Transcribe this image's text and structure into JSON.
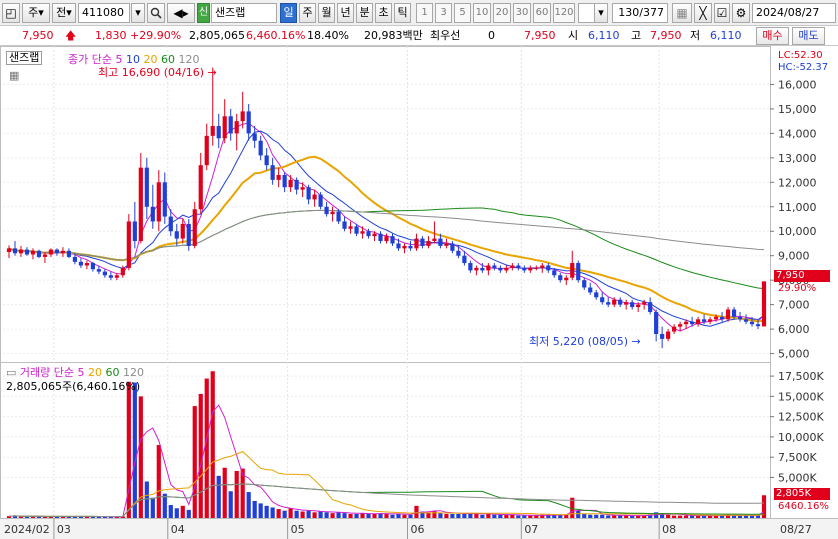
{
  "toolbar": {
    "market": "주",
    "scope": "전",
    "code": "411080",
    "badge": "신",
    "name": "샌즈랩",
    "timeframes": [
      "일",
      "주",
      "월",
      "년",
      "분",
      "초",
      "틱"
    ],
    "active_timeframe": "일",
    "periods": [
      "1",
      "3",
      "5",
      "10",
      "20",
      "30",
      "60",
      "120"
    ],
    "bar_count": "130/377",
    "date": "2024/08/27"
  },
  "pricebar": {
    "price": "7,950",
    "change": "1,830",
    "change_pct": "+29.90%",
    "volume": "2,805,065",
    "volume_pct": "6,460.16%",
    "turnover": "18.40%",
    "amount": "20,983백만",
    "preferred_label": "최우선",
    "preferred_value": "0",
    "preferred_price": "7,950",
    "open_label": "시",
    "open_value": "6,110",
    "high_label": "고",
    "high_value": "7,950",
    "low_label": "저",
    "low_value": "6,110",
    "buy_label": "매수",
    "sell_label": "매도"
  },
  "price_panel": {
    "stock_tag": "샌즈랩",
    "ma_title": "종가 단순",
    "ma_periods": [
      "5",
      "10",
      "20",
      "60",
      "120"
    ],
    "ma_colors": [
      "#d020d0",
      "#1f3fd6",
      "#e8a400",
      "#1a8a1a",
      "#8c8c8c"
    ],
    "lc": "LC:52.30",
    "hc": "HC:-52.37",
    "high_marker": "최고 16,690 (04/16)",
    "low_marker": "최저 5,220 (08/05)",
    "current_price": "7,950",
    "current_pct": "29.90%",
    "y_ticks": [
      "16,000",
      "15,000",
      "14,000",
      "13,000",
      "12,000",
      "11,000",
      "10,000",
      "9,000",
      "8,000",
      "7,000",
      "6,000",
      "5,000"
    ]
  },
  "volume_panel": {
    "title": "거래량 단순",
    "ma_periods": [
      "5",
      "20",
      "60",
      "120"
    ],
    "ma_colors": [
      "#d020d0",
      "#e8a400",
      "#1a8a1a",
      "#8c8c8c"
    ],
    "current": "2,805,065주(6,460.16%)",
    "current_tag": "2,805K",
    "current_pct": "6460.16%",
    "y_ticks": [
      "17,500K",
      "15,000K",
      "12,500K",
      "10,000K",
      "7,500K",
      "5,000K"
    ]
  },
  "x_axis": {
    "labels": [
      "2024/02",
      "03",
      "04",
      "05",
      "06",
      "07",
      "08"
    ],
    "end_label": "08/27"
  },
  "chart_data": {
    "type": "candlestick",
    "volume_unit": "K shares",
    "price_ylim": [
      4900,
      17000
    ],
    "volume_ylim": [
      0,
      18500
    ],
    "candles": [
      {
        "o": 9150,
        "h": 9420,
        "l": 8900,
        "c": 9300,
        "v": 230
      },
      {
        "o": 9300,
        "h": 9600,
        "l": 9000,
        "c": 9100,
        "v": 280
      },
      {
        "o": 9100,
        "h": 9400,
        "l": 8950,
        "c": 9250,
        "v": 180
      },
      {
        "o": 9250,
        "h": 9350,
        "l": 9000,
        "c": 9050,
        "v": 160
      },
      {
        "o": 9050,
        "h": 9300,
        "l": 8850,
        "c": 9200,
        "v": 210
      },
      {
        "o": 9200,
        "h": 9250,
        "l": 8900,
        "c": 8950,
        "v": 190
      },
      {
        "o": 8950,
        "h": 9150,
        "l": 8700,
        "c": 9050,
        "v": 170
      },
      {
        "o": 9050,
        "h": 9300,
        "l": 8950,
        "c": 9250,
        "v": 200
      },
      {
        "o": 9250,
        "h": 9300,
        "l": 9000,
        "c": 9100,
        "v": 150
      },
      {
        "o": 9100,
        "h": 9350,
        "l": 8950,
        "c": 9200,
        "v": 180
      },
      {
        "o": 9200,
        "h": 9300,
        "l": 8900,
        "c": 8950,
        "v": 170
      },
      {
        "o": 8950,
        "h": 9100,
        "l": 8650,
        "c": 8750,
        "v": 220
      },
      {
        "o": 8750,
        "h": 8900,
        "l": 8500,
        "c": 8600,
        "v": 190
      },
      {
        "o": 8600,
        "h": 8800,
        "l": 8450,
        "c": 8700,
        "v": 160
      },
      {
        "o": 8700,
        "h": 8750,
        "l": 8350,
        "c": 8450,
        "v": 180
      },
      {
        "o": 8450,
        "h": 8600,
        "l": 8250,
        "c": 8350,
        "v": 170
      },
      {
        "o": 8350,
        "h": 8450,
        "l": 8100,
        "c": 8200,
        "v": 150
      },
      {
        "o": 8200,
        "h": 8350,
        "l": 8000,
        "c": 8100,
        "v": 160
      },
      {
        "o": 8100,
        "h": 8300,
        "l": 8000,
        "c": 8200,
        "v": 140
      },
      {
        "o": 8200,
        "h": 8600,
        "l": 8100,
        "c": 8500,
        "v": 200
      },
      {
        "o": 8500,
        "h": 10700,
        "l": 8400,
        "c": 10400,
        "v": 16800
      },
      {
        "o": 10400,
        "h": 11200,
        "l": 9300,
        "c": 9600,
        "v": 16700
      },
      {
        "o": 9600,
        "h": 13200,
        "l": 9500,
        "c": 12600,
        "v": 15000
      },
      {
        "o": 12600,
        "h": 13000,
        "l": 10500,
        "c": 11000,
        "v": 4500
      },
      {
        "o": 11000,
        "h": 11900,
        "l": 10100,
        "c": 10400,
        "v": 2500
      },
      {
        "o": 10400,
        "h": 12500,
        "l": 10000,
        "c": 12000,
        "v": 9000
      },
      {
        "o": 12000,
        "h": 12400,
        "l": 10300,
        "c": 10600,
        "v": 3000
      },
      {
        "o": 10600,
        "h": 10900,
        "l": 9800,
        "c": 10000,
        "v": 1600
      },
      {
        "o": 10000,
        "h": 10300,
        "l": 9400,
        "c": 9700,
        "v": 1200
      },
      {
        "o": 9700,
        "h": 10500,
        "l": 9500,
        "c": 10300,
        "v": 1500
      },
      {
        "o": 10300,
        "h": 10500,
        "l": 9200,
        "c": 9400,
        "v": 1000
      },
      {
        "o": 9400,
        "h": 11200,
        "l": 9300,
        "c": 10900,
        "v": 13800
      },
      {
        "o": 10900,
        "h": 13200,
        "l": 10700,
        "c": 12700,
        "v": 15300
      },
      {
        "o": 12700,
        "h": 14400,
        "l": 12500,
        "c": 13900,
        "v": 17200
      },
      {
        "o": 13900,
        "h": 16690,
        "l": 13500,
        "c": 14300,
        "v": 18100
      },
      {
        "o": 14300,
        "h": 14800,
        "l": 13400,
        "c": 13800,
        "v": 5200
      },
      {
        "o": 13800,
        "h": 15400,
        "l": 13600,
        "c": 14700,
        "v": 6200
      },
      {
        "o": 14700,
        "h": 15000,
        "l": 13700,
        "c": 14000,
        "v": 3300
      },
      {
        "o": 14000,
        "h": 14800,
        "l": 13300,
        "c": 14500,
        "v": 5800
      },
      {
        "o": 14500,
        "h": 15700,
        "l": 14200,
        "c": 14900,
        "v": 6100
      },
      {
        "o": 14900,
        "h": 15200,
        "l": 13700,
        "c": 14000,
        "v": 3200
      },
      {
        "o": 14000,
        "h": 14300,
        "l": 13400,
        "c": 13700,
        "v": 2100
      },
      {
        "o": 13700,
        "h": 13900,
        "l": 12900,
        "c": 13100,
        "v": 1800
      },
      {
        "o": 13100,
        "h": 13400,
        "l": 12500,
        "c": 12700,
        "v": 1500
      },
      {
        "o": 12700,
        "h": 13000,
        "l": 11900,
        "c": 12100,
        "v": 1300
      },
      {
        "o": 12100,
        "h": 12600,
        "l": 11800,
        "c": 12300,
        "v": 1100
      },
      {
        "o": 12300,
        "h": 12400,
        "l": 11600,
        "c": 11800,
        "v": 900
      },
      {
        "o": 11800,
        "h": 12300,
        "l": 11600,
        "c": 12100,
        "v": 1200
      },
      {
        "o": 12100,
        "h": 12200,
        "l": 11500,
        "c": 11700,
        "v": 900
      },
      {
        "o": 11700,
        "h": 12000,
        "l": 11400,
        "c": 11800,
        "v": 800
      },
      {
        "o": 11800,
        "h": 11900,
        "l": 11100,
        "c": 11300,
        "v": 900
      },
      {
        "o": 11300,
        "h": 11700,
        "l": 11000,
        "c": 11500,
        "v": 700
      },
      {
        "o": 11500,
        "h": 11600,
        "l": 10900,
        "c": 11000,
        "v": 800
      },
      {
        "o": 11000,
        "h": 11200,
        "l": 10600,
        "c": 10700,
        "v": 700
      },
      {
        "o": 10700,
        "h": 11000,
        "l": 10400,
        "c": 10800,
        "v": 600
      },
      {
        "o": 10800,
        "h": 10900,
        "l": 10300,
        "c": 10400,
        "v": 700
      },
      {
        "o": 10400,
        "h": 10600,
        "l": 10000,
        "c": 10100,
        "v": 600
      },
      {
        "o": 10100,
        "h": 10400,
        "l": 9900,
        "c": 10200,
        "v": 500
      },
      {
        "o": 10200,
        "h": 10300,
        "l": 9800,
        "c": 9900,
        "v": 500
      },
      {
        "o": 9900,
        "h": 10200,
        "l": 9700,
        "c": 10000,
        "v": 600
      },
      {
        "o": 10000,
        "h": 10100,
        "l": 9700,
        "c": 9800,
        "v": 500
      },
      {
        "o": 9800,
        "h": 10000,
        "l": 9600,
        "c": 9900,
        "v": 500
      },
      {
        "o": 9900,
        "h": 10000,
        "l": 9500,
        "c": 9600,
        "v": 600
      },
      {
        "o": 9600,
        "h": 9900,
        "l": 9500,
        "c": 9800,
        "v": 500
      },
      {
        "o": 9800,
        "h": 9900,
        "l": 9400,
        "c": 9500,
        "v": 400
      },
      {
        "o": 9500,
        "h": 9700,
        "l": 9200,
        "c": 9300,
        "v": 500
      },
      {
        "o": 9300,
        "h": 9500,
        "l": 9100,
        "c": 9400,
        "v": 400
      },
      {
        "o": 9400,
        "h": 9600,
        "l": 9200,
        "c": 9300,
        "v": 400
      },
      {
        "o": 9300,
        "h": 9900,
        "l": 9200,
        "c": 9700,
        "v": 1500
      },
      {
        "o": 9700,
        "h": 9800,
        "l": 9300,
        "c": 9400,
        "v": 800
      },
      {
        "o": 9400,
        "h": 9800,
        "l": 9300,
        "c": 9600,
        "v": 700
      },
      {
        "o": 9600,
        "h": 10400,
        "l": 9500,
        "c": 9700,
        "v": 900
      },
      {
        "o": 9700,
        "h": 9900,
        "l": 9300,
        "c": 9400,
        "v": 600
      },
      {
        "o": 9400,
        "h": 9700,
        "l": 9300,
        "c": 9500,
        "v": 500
      },
      {
        "o": 9500,
        "h": 9600,
        "l": 9100,
        "c": 9200,
        "v": 500
      },
      {
        "o": 9200,
        "h": 9400,
        "l": 8900,
        "c": 9000,
        "v": 500
      },
      {
        "o": 9000,
        "h": 9200,
        "l": 8600,
        "c": 8700,
        "v": 600
      },
      {
        "o": 8700,
        "h": 8800,
        "l": 8300,
        "c": 8400,
        "v": 600
      },
      {
        "o": 8400,
        "h": 8600,
        "l": 8200,
        "c": 8500,
        "v": 500
      },
      {
        "o": 8500,
        "h": 8700,
        "l": 8300,
        "c": 8400,
        "v": 400
      },
      {
        "o": 8400,
        "h": 8700,
        "l": 8200,
        "c": 8600,
        "v": 500
      },
      {
        "o": 8600,
        "h": 8700,
        "l": 8400,
        "c": 8500,
        "v": 400
      },
      {
        "o": 8500,
        "h": 8600,
        "l": 8300,
        "c": 8400,
        "v": 400
      },
      {
        "o": 8400,
        "h": 8600,
        "l": 8300,
        "c": 8500,
        "v": 400
      },
      {
        "o": 8500,
        "h": 8700,
        "l": 8400,
        "c": 8600,
        "v": 400
      },
      {
        "o": 8600,
        "h": 8700,
        "l": 8400,
        "c": 8500,
        "v": 300
      },
      {
        "o": 8500,
        "h": 8600,
        "l": 8300,
        "c": 8400,
        "v": 300
      },
      {
        "o": 8400,
        "h": 8600,
        "l": 8300,
        "c": 8500,
        "v": 300
      },
      {
        "o": 8500,
        "h": 8600,
        "l": 8400,
        "c": 8500,
        "v": 300
      },
      {
        "o": 8500,
        "h": 8700,
        "l": 8300,
        "c": 8600,
        "v": 400
      },
      {
        "o": 8600,
        "h": 8700,
        "l": 8300,
        "c": 8400,
        "v": 400
      },
      {
        "o": 8400,
        "h": 8500,
        "l": 8100,
        "c": 8200,
        "v": 400
      },
      {
        "o": 8200,
        "h": 8300,
        "l": 7900,
        "c": 8000,
        "v": 400
      },
      {
        "o": 8000,
        "h": 8200,
        "l": 7800,
        "c": 8100,
        "v": 400
      },
      {
        "o": 8100,
        "h": 9200,
        "l": 8000,
        "c": 8700,
        "v": 2500
      },
      {
        "o": 8700,
        "h": 8800,
        "l": 7900,
        "c": 8000,
        "v": 900
      },
      {
        "o": 8000,
        "h": 8100,
        "l": 7600,
        "c": 7700,
        "v": 500
      },
      {
        "o": 7700,
        "h": 7900,
        "l": 7400,
        "c": 7500,
        "v": 400
      },
      {
        "o": 7500,
        "h": 7600,
        "l": 7200,
        "c": 7300,
        "v": 400
      },
      {
        "o": 7300,
        "h": 7500,
        "l": 7000,
        "c": 7100,
        "v": 400
      },
      {
        "o": 7100,
        "h": 7300,
        "l": 6900,
        "c": 7000,
        "v": 300
      },
      {
        "o": 7000,
        "h": 7300,
        "l": 6900,
        "c": 7200,
        "v": 300
      },
      {
        "o": 7200,
        "h": 7300,
        "l": 6900,
        "c": 7000,
        "v": 300
      },
      {
        "o": 7000,
        "h": 7200,
        "l": 6800,
        "c": 7100,
        "v": 300
      },
      {
        "o": 7100,
        "h": 7200,
        "l": 6800,
        "c": 6900,
        "v": 300
      },
      {
        "o": 6900,
        "h": 7100,
        "l": 6700,
        "c": 7000,
        "v": 300
      },
      {
        "o": 7000,
        "h": 7200,
        "l": 6800,
        "c": 7100,
        "v": 300
      },
      {
        "o": 7100,
        "h": 7300,
        "l": 6600,
        "c": 6700,
        "v": 400
      },
      {
        "o": 6700,
        "h": 6800,
        "l": 5500,
        "c": 5800,
        "v": 700
      },
      {
        "o": 5800,
        "h": 6100,
        "l": 5220,
        "c": 5600,
        "v": 600
      },
      {
        "o": 5600,
        "h": 6000,
        "l": 5500,
        "c": 5900,
        "v": 400
      },
      {
        "o": 5900,
        "h": 6200,
        "l": 5800,
        "c": 6100,
        "v": 300
      },
      {
        "o": 6100,
        "h": 6300,
        "l": 5900,
        "c": 6200,
        "v": 300
      },
      {
        "o": 6200,
        "h": 6400,
        "l": 6000,
        "c": 6300,
        "v": 300
      },
      {
        "o": 6300,
        "h": 6500,
        "l": 6100,
        "c": 6200,
        "v": 300
      },
      {
        "o": 6200,
        "h": 6500,
        "l": 6100,
        "c": 6400,
        "v": 300
      },
      {
        "o": 6400,
        "h": 6600,
        "l": 6200,
        "c": 6300,
        "v": 300
      },
      {
        "o": 6300,
        "h": 6500,
        "l": 6200,
        "c": 6400,
        "v": 300
      },
      {
        "o": 6400,
        "h": 6600,
        "l": 6300,
        "c": 6500,
        "v": 300
      },
      {
        "o": 6500,
        "h": 6700,
        "l": 6300,
        "c": 6400,
        "v": 300
      },
      {
        "o": 6400,
        "h": 6900,
        "l": 6300,
        "c": 6800,
        "v": 400
      },
      {
        "o": 6800,
        "h": 6900,
        "l": 6400,
        "c": 6500,
        "v": 300
      },
      {
        "o": 6500,
        "h": 6700,
        "l": 6300,
        "c": 6400,
        "v": 300
      },
      {
        "o": 6400,
        "h": 6600,
        "l": 6200,
        "c": 6300,
        "v": 300
      },
      {
        "o": 6300,
        "h": 6500,
        "l": 6100,
        "c": 6200,
        "v": 300
      },
      {
        "o": 6200,
        "h": 6400,
        "l": 6000,
        "c": 6120,
        "v": 300
      },
      {
        "o": 6110,
        "h": 7950,
        "l": 6110,
        "c": 7950,
        "v": 2805
      }
    ],
    "month_starts": [
      {
        "label": "03",
        "index": 8
      },
      {
        "label": "04",
        "index": 27
      },
      {
        "label": "05",
        "index": 47
      },
      {
        "label": "06",
        "index": 67
      },
      {
        "label": "07",
        "index": 86
      },
      {
        "label": "08",
        "index": 109
      }
    ]
  }
}
